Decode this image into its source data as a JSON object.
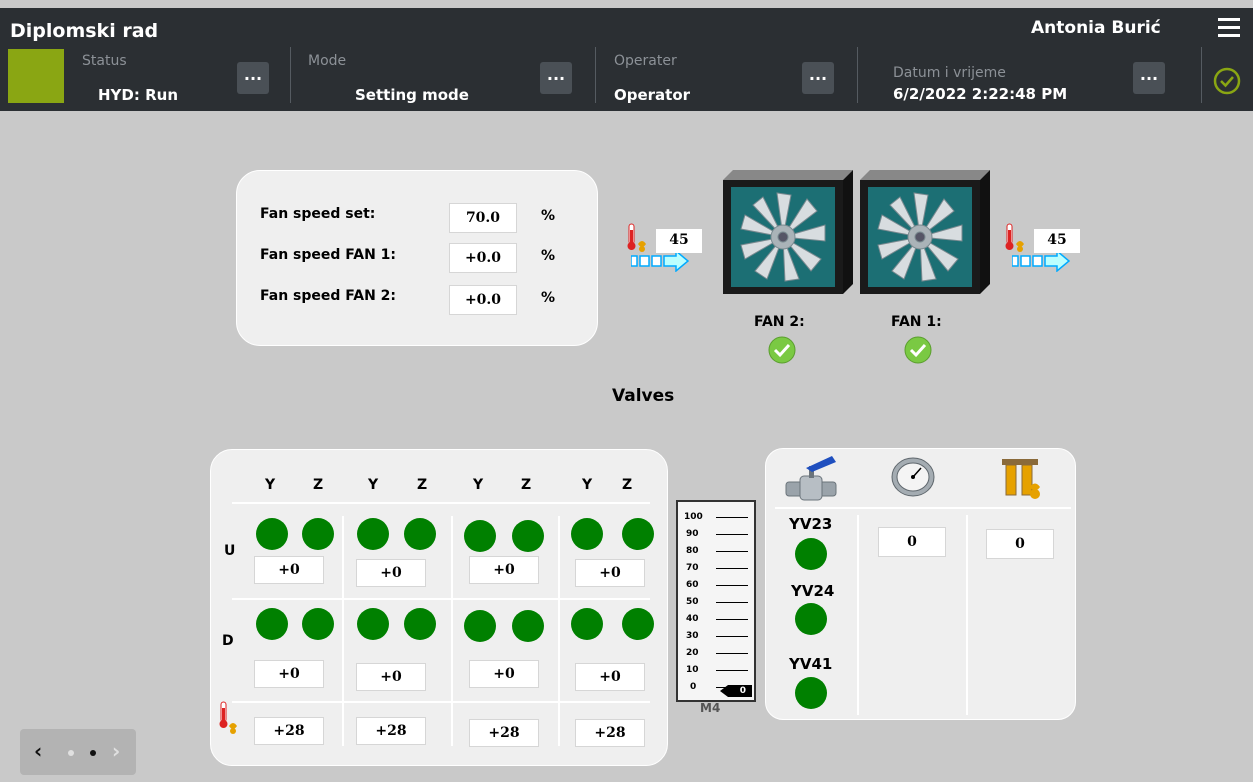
{
  "header": {
    "title": "Diplomski rad",
    "user": "Antonia Burić",
    "menu_icon": "hamburger-menu-icon",
    "status_color": "#8aa613",
    "fields": [
      {
        "label": "Status",
        "value": "HYD: Run"
      },
      {
        "label": "Mode",
        "value": "Setting mode"
      },
      {
        "label": "Operater",
        "value": "Operator"
      },
      {
        "label": "Datum i vrijeme",
        "value": "6/2/2022 2:22:48 PM"
      }
    ],
    "more_label": "...",
    "check_color": "#8aa613"
  },
  "fan_speed": {
    "rows": [
      {
        "label": "Fan speed set:",
        "value": "70.0",
        "unit": "%"
      },
      {
        "label": "Fan speed FAN 1:",
        "value": "+0.0",
        "unit": "%"
      },
      {
        "label": "Fan speed FAN 2:",
        "value": "+0.0",
        "unit": "%"
      }
    ]
  },
  "fans": {
    "temp_in": "45",
    "temp_out": "45",
    "fan2_label": "FAN 2:",
    "fan1_label": "FAN 1:",
    "ok_color": "#7ac943"
  },
  "valves": {
    "title": "Valves",
    "column_headers": [
      "Y",
      "Z",
      "Y",
      "Z",
      "Y",
      "Z",
      "Y",
      "Z"
    ],
    "row_labels": [
      "U",
      "D"
    ],
    "u_values": [
      "+0",
      "+0",
      "+0",
      "+0"
    ],
    "d_values": [
      "+0",
      "+0",
      "+0",
      "+0"
    ],
    "temp_values": [
      "+28",
      "+28",
      "+28",
      "+28"
    ],
    "dot_color": "#008000"
  },
  "gauge": {
    "ticks": [
      "100",
      "90",
      "80",
      "70",
      "60",
      "50",
      "40",
      "30",
      "20",
      "10",
      "0"
    ],
    "value": "0",
    "caption": "M4"
  },
  "right_panel": {
    "valves": [
      "YV23",
      "YV24",
      "YV41"
    ],
    "pressure": "0",
    "filter": "0"
  },
  "pager": {
    "prev": "‹",
    "next": "›",
    "pages": 2,
    "active": 2
  }
}
